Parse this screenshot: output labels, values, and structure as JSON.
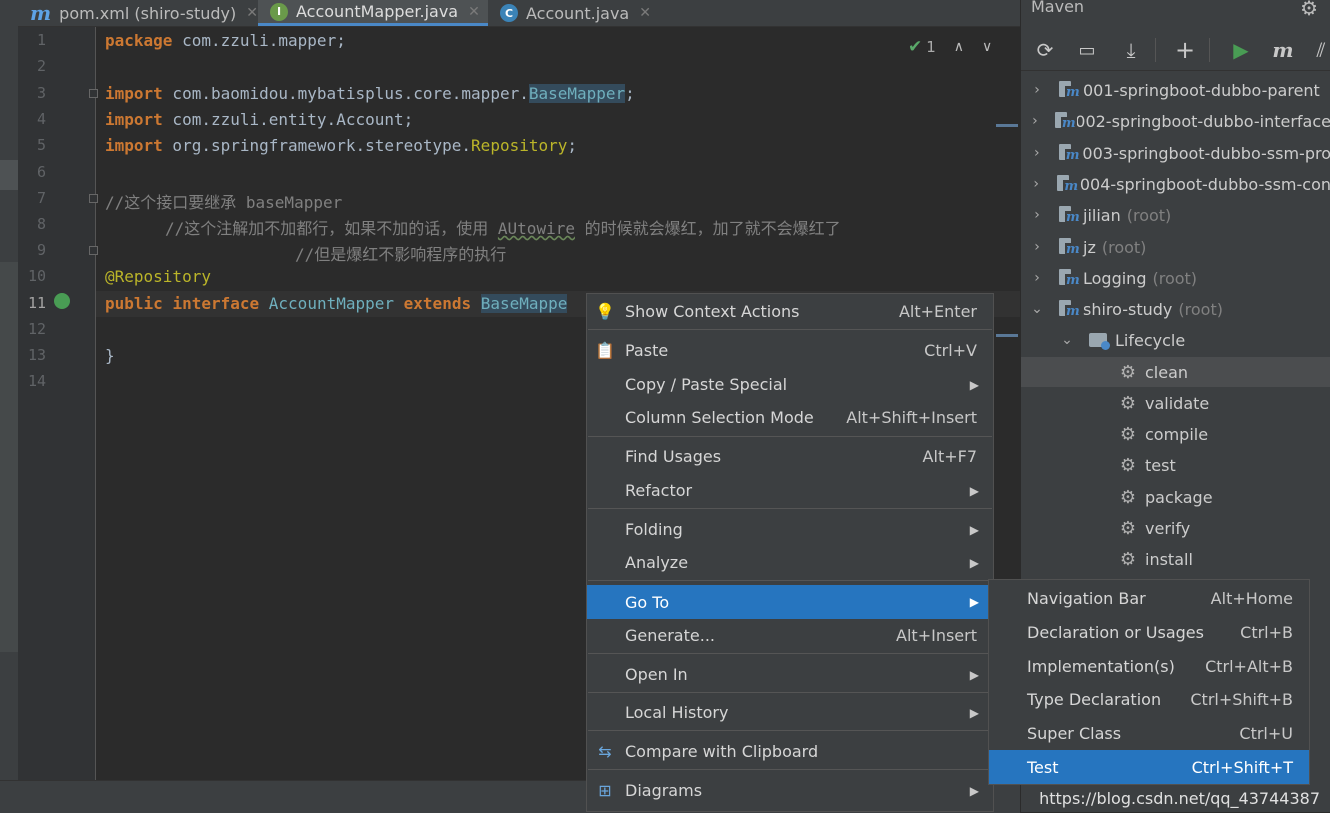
{
  "tabs": [
    {
      "label": "pom.xml (shiro-study)",
      "icon": "maven-icon",
      "active": false
    },
    {
      "label": "AccountMapper.java",
      "icon": "interface-icon",
      "icon_letter": "I",
      "active": true
    },
    {
      "label": "Account.java",
      "icon": "class-icon",
      "icon_letter": "C",
      "active": false
    }
  ],
  "editor": {
    "line_numbers": [
      "1",
      "2",
      "3",
      "4",
      "5",
      "6",
      "7",
      "8",
      "9",
      "10",
      "11",
      "12",
      "13",
      "14"
    ],
    "inspection_count": "1",
    "code": {
      "l1_kw": "package",
      "l1_rest": " com.zzuli.mapper;",
      "l3_kw": "import",
      "l3_pkg": " com.baomidou.mybatisplus.core.mapper.",
      "l3_cls": "BaseMapper",
      "l3_end": ";",
      "l4_kw": "import",
      "l4_pkg": " com.zzuli.entity.",
      "l4_cls": "Account",
      "l4_end": ";",
      "l5_kw": "import",
      "l5_pkg": " org.springframework.stereotype.",
      "l5_cls": "Repository",
      "l5_end": ";",
      "l7": "//这个接口要继承 baseMapper",
      "l8_a": "//这个注解加不加都行，如果不加的话，使用 ",
      "l8_typo": "AUtowire",
      "l8_b": " 的时候就会爆红，加了就不会爆红了",
      "l9": "//但是爆红不影响程序的执行",
      "l10": "@Repository",
      "l11_kw1": "public",
      "l11_kw2": "interface",
      "l11_name": "AccountMapper",
      "l11_kw3": "extends",
      "l11_base": "BaseMappe",
      "l13": "}"
    }
  },
  "maven": {
    "title": "Maven",
    "projects": [
      {
        "name": "001-springboot-dubbo-parent",
        "tag": ""
      },
      {
        "name": "002-springboot-dubbo-interface",
        "tag": ""
      },
      {
        "name": "003-springboot-dubbo-ssm-pro",
        "tag": ""
      },
      {
        "name": "004-springboot-dubbo-ssm-con",
        "tag": ""
      },
      {
        "name": "jilian",
        "tag": "(root)"
      },
      {
        "name": "jz",
        "tag": "(root)"
      },
      {
        "name": "Logging",
        "tag": "(root)"
      },
      {
        "name": "shiro-study",
        "tag": "(root)"
      }
    ],
    "lifecycle_label": "Lifecycle",
    "lifecycle": [
      "clean",
      "validate",
      "compile",
      "test",
      "package",
      "verify",
      "install"
    ]
  },
  "context_menu": {
    "items": [
      {
        "label": "Show Context Actions",
        "shortcut": "Alt+Enter",
        "icon": "bulb-icon"
      },
      {
        "label": "Paste",
        "shortcut": "Ctrl+V",
        "icon": "clipboard-icon"
      },
      {
        "label": "Copy / Paste Special",
        "submenu": true
      },
      {
        "label": "Column Selection Mode",
        "shortcut": "Alt+Shift+Insert"
      },
      {
        "label": "Find Usages",
        "shortcut": "Alt+F7"
      },
      {
        "label": "Refactor",
        "submenu": true
      },
      {
        "label": "Folding",
        "submenu": true
      },
      {
        "label": "Analyze",
        "submenu": true
      },
      {
        "label": "Go To",
        "submenu": true,
        "selected": true
      },
      {
        "label": "Generate...",
        "shortcut": "Alt+Insert"
      },
      {
        "label": "Open In",
        "submenu": true
      },
      {
        "label": "Local History",
        "submenu": true
      },
      {
        "label": "Compare with Clipboard",
        "icon": "compare-icon"
      },
      {
        "label": "Diagrams",
        "submenu": true,
        "icon": "diagram-icon"
      }
    ]
  },
  "goto_submenu": {
    "items": [
      {
        "label": "Navigation Bar",
        "shortcut": "Alt+Home"
      },
      {
        "label": "Declaration or Usages",
        "shortcut": "Ctrl+B"
      },
      {
        "label": "Implementation(s)",
        "shortcut": "Ctrl+Alt+B"
      },
      {
        "label": "Type Declaration",
        "shortcut": "Ctrl+Shift+B"
      },
      {
        "label": "Super Class",
        "shortcut": "Ctrl+U"
      },
      {
        "label": "Test",
        "shortcut": "Ctrl+Shift+T",
        "selected": true
      }
    ]
  },
  "watermark": "https://blog.csdn.net/qq_43744387",
  "colors": {
    "accent": "#2675bf",
    "keyword": "#cc7832",
    "annotation": "#bbb529",
    "comment": "#808080"
  }
}
